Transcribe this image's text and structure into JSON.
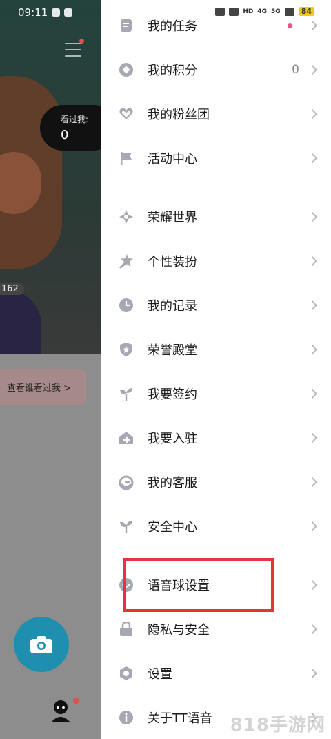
{
  "status_bar": {
    "time": "09:11",
    "net1": "4G",
    "net2": "5G",
    "battery": "84",
    "hd": "HD"
  },
  "background": {
    "viewed_label": "看过我:",
    "viewed_count": "0",
    "count_badge": "162",
    "who_viewed_button": "查看谁看过我 >"
  },
  "menu": {
    "items": [
      {
        "label": "我的任务",
        "icon": "task-icon",
        "badge_dot": true
      },
      {
        "label": "我的积分",
        "icon": "points-icon",
        "value": "0"
      },
      {
        "label": "我的粉丝团",
        "icon": "fan-club-icon"
      },
      {
        "label": "活动中心",
        "icon": "flag-icon"
      },
      {
        "label": "荣耀世界",
        "icon": "honor-world-icon"
      },
      {
        "label": "个性装扮",
        "icon": "dress-up-icon"
      },
      {
        "label": "我的记录",
        "icon": "clock-icon"
      },
      {
        "label": "荣誉殿堂",
        "icon": "shield-star-icon"
      },
      {
        "label": "我要签约",
        "icon": "sprout-icon"
      },
      {
        "label": "我要入驻",
        "icon": "house-arrow-icon"
      },
      {
        "label": "我的客服",
        "icon": "headset-icon"
      },
      {
        "label": "安全中心",
        "icon": "sprout-icon"
      },
      {
        "label": "语音球设置",
        "icon": "voice-ball-icon"
      },
      {
        "label": "隐私与安全",
        "icon": "lock-icon"
      },
      {
        "label": "设置",
        "icon": "gear-icon"
      },
      {
        "label": "关于TT语音",
        "icon": "info-icon"
      }
    ]
  },
  "watermark": "818手游网",
  "colors": {
    "accent_highlight": "#e8323c",
    "icon_gray": "#a6a9b4",
    "drawer_bg": "#ffffff"
  }
}
